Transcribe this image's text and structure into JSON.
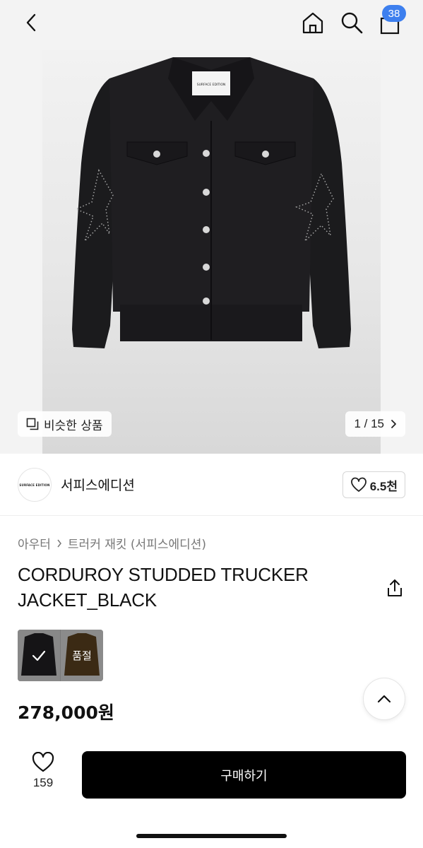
{
  "header": {
    "back_icon": "chevron-left-icon",
    "home_icon": "home-icon",
    "search_icon": "search-icon",
    "cart_icon": "shopping-bag-icon",
    "cart_count": "38",
    "cart_badge_color": "#3d7fee"
  },
  "gallery": {
    "similar_label": "비슷한 상품",
    "similar_icon": "copy-icon",
    "pager": "1 / 15",
    "pager_icon": "chevron-right-icon",
    "image": "black corduroy trucker jacket with studded sleeves",
    "image_tag": "SURFACE EDITION"
  },
  "store": {
    "logo_text": "SURFACE EDITION",
    "name": "서피스에디션",
    "likes": "6.5천",
    "like_icon": "heart-icon"
  },
  "breadcrumb": {
    "category": "아우터",
    "subcategory": "트러커 재킷 (서피스에디션)"
  },
  "product": {
    "title": "CORDUROY STUDDED TRUCKER JACKET_BLACK",
    "share_icon": "share-icon",
    "variants": [
      {
        "color": "black",
        "selected": true
      },
      {
        "color": "brown",
        "status": "품절"
      }
    ],
    "price": "278,000원"
  },
  "bottom": {
    "wish_count": "159",
    "buy_label": "구매하기"
  },
  "colors": {
    "accent": "#3d7fee",
    "buy_button": "#000000",
    "header_bg": "#f3f3f3"
  }
}
